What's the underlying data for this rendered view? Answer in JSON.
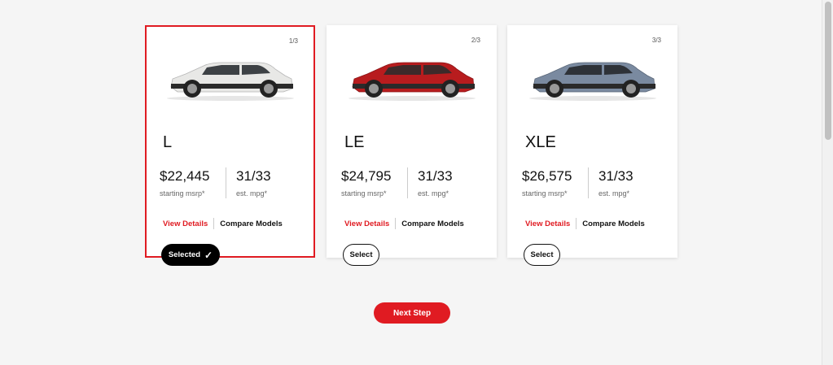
{
  "cards": [
    {
      "counter": "1/3",
      "trim": "L",
      "price": "$22,445",
      "price_label": "starting msrp*",
      "mpg": "31/33",
      "mpg_label": "est. mpg*",
      "view_details": "View Details",
      "compare_models": "Compare Models",
      "button_label": "Selected",
      "selected": true,
      "car_color": "#e8e8e6"
    },
    {
      "counter": "2/3",
      "trim": "LE",
      "price": "$24,795",
      "price_label": "starting msrp*",
      "mpg": "31/33",
      "mpg_label": "est. mpg*",
      "view_details": "View Details",
      "compare_models": "Compare Models",
      "button_label": "Select",
      "selected": false,
      "car_color": "#b81c1e"
    },
    {
      "counter": "3/3",
      "trim": "XLE",
      "price": "$26,575",
      "price_label": "starting msrp*",
      "mpg": "31/33",
      "mpg_label": "est. mpg*",
      "view_details": "View Details",
      "compare_models": "Compare Models",
      "button_label": "Select",
      "selected": false,
      "car_color": "#7a8aa0"
    }
  ],
  "next_step": "Next Step",
  "colors": {
    "accent": "#e01b22",
    "background": "#f5f5f5"
  },
  "icons": {
    "selected_check": "checkmark-icon"
  }
}
